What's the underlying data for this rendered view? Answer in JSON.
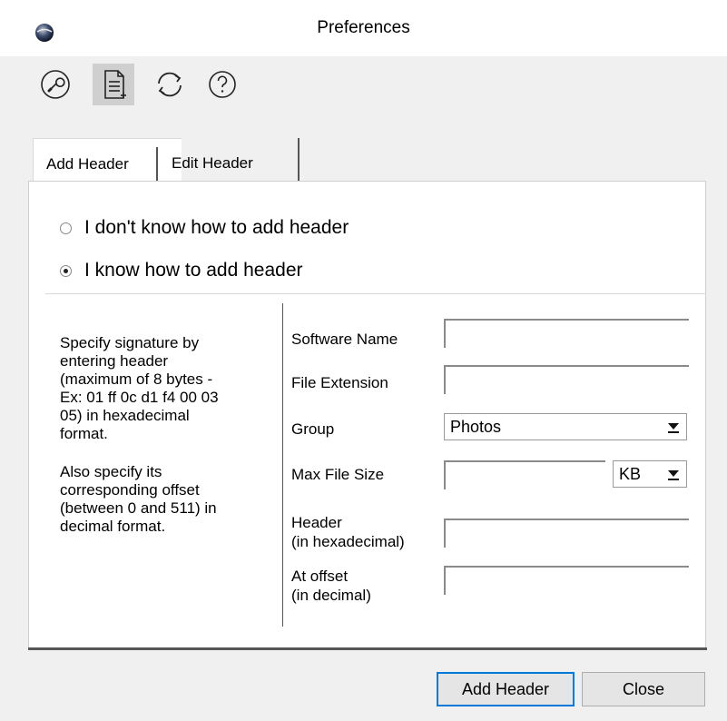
{
  "window": {
    "title": "Preferences"
  },
  "toolbar": {
    "buttons": [
      {
        "icon": "wrench-circle-icon",
        "active": false
      },
      {
        "icon": "document-icon",
        "active": true
      },
      {
        "icon": "refresh-icon",
        "active": false
      },
      {
        "icon": "help-icon",
        "active": false
      }
    ]
  },
  "tabs": [
    {
      "label": "Add Header",
      "selected": true
    },
    {
      "label": "Edit Header",
      "selected": false
    }
  ],
  "options": {
    "dont_know": "I don't know how to add header",
    "know": "I know how to add header",
    "selected": "know"
  },
  "help": {
    "paragraph1": "Specify signature by\nentering header\n(maximum of 8 bytes -\nEx: 01 ff 0c d1 f4 00 03\n05) in hexadecimal\nformat.",
    "paragraph2": "Also specify its\ncorresponding offset\n(between 0 and 511) in\ndecimal format."
  },
  "form": {
    "software_name": {
      "label": "Software Name",
      "value": ""
    },
    "file_extension": {
      "label": "File Extension",
      "value": ""
    },
    "group": {
      "label": "Group",
      "value": "Photos"
    },
    "max_file_size": {
      "label": "Max File Size",
      "value": "",
      "unit": "KB"
    },
    "header": {
      "label": "Header\n(in hexadecimal)",
      "value": ""
    },
    "offset": {
      "label": "At offset\n(in decimal)",
      "value": ""
    }
  },
  "buttons": {
    "add": "Add Header",
    "close": "Close"
  }
}
